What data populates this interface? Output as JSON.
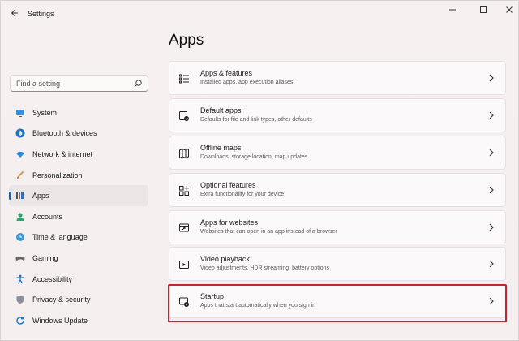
{
  "window": {
    "title": "Settings",
    "controls": [
      "minimize",
      "maximize",
      "close"
    ]
  },
  "search": {
    "placeholder": "Find a setting"
  },
  "sidebar": {
    "items": [
      {
        "label": "System",
        "icon": "monitor-icon",
        "selected": false
      },
      {
        "label": "Bluetooth & devices",
        "icon": "bluetooth-icon",
        "selected": false
      },
      {
        "label": "Network & internet",
        "icon": "wifi-icon",
        "selected": false
      },
      {
        "label": "Personalization",
        "icon": "brush-icon",
        "selected": false
      },
      {
        "label": "Apps",
        "icon": "apps-icon",
        "selected": true
      },
      {
        "label": "Accounts",
        "icon": "person-icon",
        "selected": false
      },
      {
        "label": "Time & language",
        "icon": "globe-clock-icon",
        "selected": false
      },
      {
        "label": "Gaming",
        "icon": "gamepad-icon",
        "selected": false
      },
      {
        "label": "Accessibility",
        "icon": "accessibility-icon",
        "selected": false
      },
      {
        "label": "Privacy & security",
        "icon": "shield-icon",
        "selected": false
      },
      {
        "label": "Windows Update",
        "icon": "update-icon",
        "selected": false
      }
    ]
  },
  "main": {
    "title": "Apps",
    "cards": [
      {
        "title": "Apps & features",
        "description": "Installed apps, app execution aliases",
        "icon": "list-icon"
      },
      {
        "title": "Default apps",
        "description": "Defaults for file and link types, other defaults",
        "icon": "default-apps-icon"
      },
      {
        "title": "Offline maps",
        "description": "Downloads, storage location, map updates",
        "icon": "map-icon"
      },
      {
        "title": "Optional features",
        "description": "Extra functionality for your device",
        "icon": "grid-add-icon"
      },
      {
        "title": "Apps for websites",
        "description": "Websites that can open in an app instead of a browser",
        "icon": "web-app-icon"
      },
      {
        "title": "Video playback",
        "description": "Video adjustments, HDR streaming, battery options",
        "icon": "video-icon"
      },
      {
        "title": "Startup",
        "description": "Apps that start automatically when you sign in",
        "icon": "startup-icon",
        "highlighted": true
      }
    ]
  },
  "colors": {
    "accent": "#0067c0",
    "highlight_border": "#c4262d",
    "background": "#f6efee",
    "card": "#fbf9f9"
  }
}
